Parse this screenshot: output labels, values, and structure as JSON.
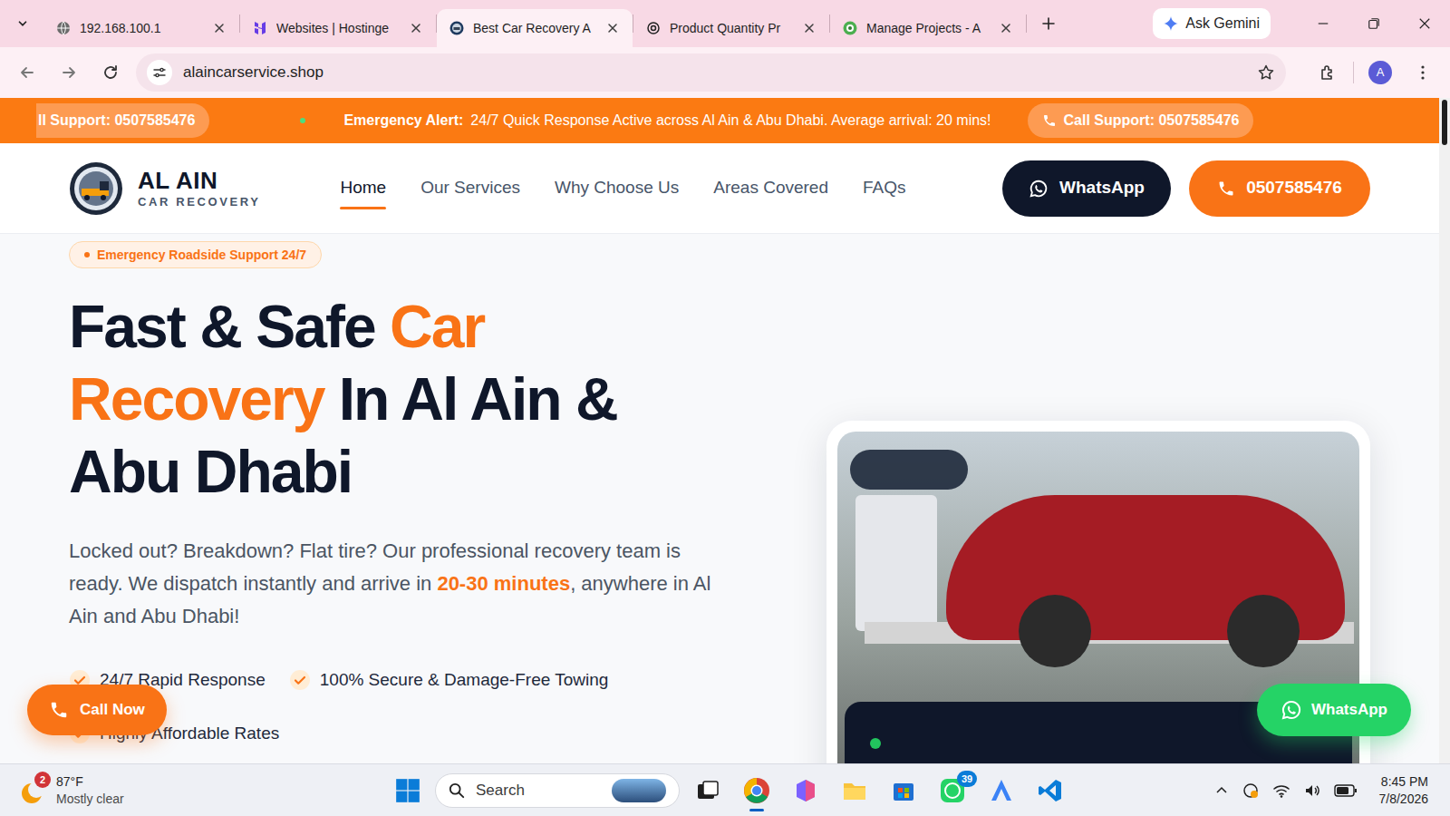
{
  "browser": {
    "tabs": [
      {
        "label": "192.168.100.1",
        "selected": false,
        "kind": "globe"
      },
      {
        "label": "Websites | Hostinge",
        "selected": false,
        "kind": "hostinger"
      },
      {
        "label": "Best Car Recovery A",
        "selected": true,
        "kind": "site"
      },
      {
        "label": "Product Quantity Pr",
        "selected": false,
        "kind": "openai"
      },
      {
        "label": "Manage Projects - A",
        "selected": false,
        "kind": "projects"
      }
    ],
    "gemini": "Ask Gemini",
    "address": "alaincarservice.shop",
    "profile": "A"
  },
  "site": {
    "marquee": [
      {
        "kind": "pill",
        "text": "ll Support: 0507585476"
      },
      {
        "kind": "dot"
      },
      {
        "kind": "alert",
        "label": "Emergency Alert:",
        "text": "24/7 Quick Response Active across Al Ain & Abu Dhabi. Average arrival: 20 mins!"
      },
      {
        "kind": "pill",
        "text": "Call Support: 0507585476"
      }
    ],
    "brand": {
      "name": "AL AIN",
      "tagline": "CAR RECOVERY"
    },
    "nav": [
      {
        "label": "Home",
        "selected": true
      },
      {
        "label": "Our Services",
        "selected": false
      },
      {
        "label": "Why Choose Us",
        "selected": false
      },
      {
        "label": "Areas Covered",
        "selected": false
      },
      {
        "label": "FAQs",
        "selected": false
      }
    ],
    "whatsapp": "WhatsApp",
    "phone": "0507585476",
    "badge": "Emergency Roadside Support 24/7",
    "headline": [
      [
        {
          "text": "Fast & Safe ",
          "highlight": false
        },
        {
          "text": "Car",
          "highlight": true
        }
      ],
      [
        {
          "text": "Recovery",
          "highlight": true
        },
        {
          "text": " In Al Ain &",
          "highlight": false
        }
      ],
      [
        {
          "text": "Abu Dhabi",
          "highlight": false
        }
      ]
    ],
    "intro": [
      {
        "text": "Locked out? Breakdown? Flat tire? Our professional recovery team is ready. We dispatch instantly and arrive in ",
        "highlight": false
      },
      {
        "text": "20-30 minutes",
        "highlight": true
      },
      {
        "text": ", anywhere in Al Ain and Abu Dhabi!",
        "highlight": false
      }
    ],
    "features": [
      "24/7 Rapid Response",
      "100% Secure & Damage-Free Towing",
      "Highly Affordable Rates"
    ],
    "call_now": "Call Now",
    "float_whatsapp": "WhatsApp"
  },
  "taskbar": {
    "temperature": "87°F",
    "weather": "Mostly clear",
    "weather_badge": "2",
    "search": "Search",
    "whatsapp_badge": "39",
    "time": "8:45 PM",
    "date": "7/8/2026"
  }
}
